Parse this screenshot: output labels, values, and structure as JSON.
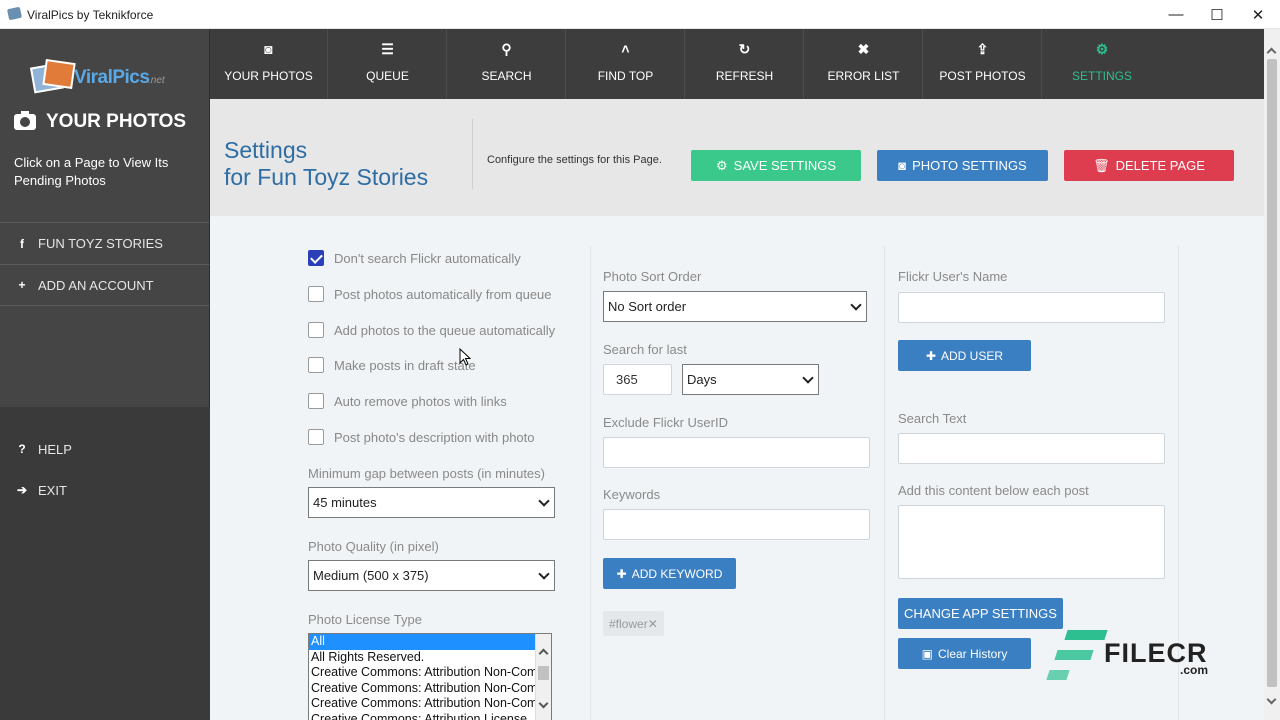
{
  "window": {
    "title": "ViralPics by Teknikforce",
    "minimize": "—",
    "maximize": "☐",
    "close": "✕"
  },
  "sidebar": {
    "logo_text": "ViralPics",
    "logo_suffix": ".net",
    "heading": "YOUR PHOTOS",
    "description": "Click on a Page to View Its Pending Photos",
    "pages": [
      {
        "label": "FUN TOYZ STORIES",
        "icon": "facebook-icon",
        "glyph": "f"
      }
    ],
    "add_account": {
      "label": "ADD AN ACCOUNT",
      "icon": "plus-circle-icon",
      "glyph": "+"
    },
    "help": {
      "label": "HELP",
      "icon": "question-icon",
      "glyph": "?"
    },
    "exit": {
      "label": "EXIT",
      "icon": "exit-arrow-icon",
      "glyph": "➔"
    }
  },
  "topnav": [
    {
      "label": "YOUR PHOTOS",
      "icon": "camera-icon",
      "glyph": "◙"
    },
    {
      "label": "QUEUE",
      "icon": "list-icon",
      "glyph": "☰"
    },
    {
      "label": "SEARCH",
      "icon": "search-icon",
      "glyph": "⚲"
    },
    {
      "label": "FIND TOP",
      "icon": "chevron-up-icon",
      "glyph": "˄"
    },
    {
      "label": "REFRESH",
      "icon": "refresh-icon",
      "glyph": "↻"
    },
    {
      "label": "ERROR LIST",
      "icon": "times-icon",
      "glyph": "✖"
    },
    {
      "label": "POST PHOTOS",
      "icon": "upload-icon",
      "glyph": "⇪"
    },
    {
      "label": "SETTINGS",
      "icon": "gear-icon",
      "glyph": "⚙",
      "active": true
    }
  ],
  "header": {
    "title_line1": "Settings",
    "title_line2": "for Fun Toyz Stories",
    "config_text": "Configure the settings for this Page.",
    "save_settings": "SAVE SETTINGS",
    "photo_settings": "PHOTO SETTINGS",
    "delete_page": "DELETE PAGE",
    "colors": {
      "save": "#3ac98b",
      "photo": "#3a7fc2",
      "delete": "#de3d4f"
    }
  },
  "options": [
    {
      "label": "Don't search Flickr automatically",
      "checked": true
    },
    {
      "label": "Post photos automatically from queue",
      "checked": false
    },
    {
      "label": "Add photos to the queue automatically",
      "checked": false
    },
    {
      "label": "Make posts in draft state",
      "checked": false
    },
    {
      "label": "Auto remove photos with links",
      "checked": false
    },
    {
      "label": "Post photo's description with photo",
      "checked": false
    }
  ],
  "min_gap": {
    "label": "Minimum gap between posts (in minutes)",
    "value": "45 minutes"
  },
  "photo_quality": {
    "label": "Photo Quality (in pixel)",
    "value": "Medium (500 x 375)"
  },
  "license": {
    "label": "Photo License Type",
    "options": [
      {
        "text": "All",
        "selected": true
      },
      {
        "text": "All Rights Reserved."
      },
      {
        "text": "Creative Commons: Attribution Non-Commercial"
      },
      {
        "text": "Creative Commons: Attribution Non-Commercial"
      },
      {
        "text": "Creative Commons: Attribution Non-Commercial"
      },
      {
        "text": "Creative Commons: Attribution License"
      }
    ]
  },
  "sort_order": {
    "label": "Photo Sort Order",
    "value": "No Sort order"
  },
  "search_last": {
    "label": "Search for last",
    "number": "365",
    "unit": "Days"
  },
  "exclude_user": {
    "label": "Exclude Flickr UserID",
    "value": ""
  },
  "keywords": {
    "label": "Keywords",
    "value": "",
    "add_button": "ADD KEYWORD",
    "tags": [
      "#flower"
    ],
    "tag_remove": "✕"
  },
  "flickr_user": {
    "label": "Flickr User's Name",
    "value": "",
    "add_button": "ADD USER"
  },
  "search_text": {
    "label": "Search Text",
    "value": ""
  },
  "below_content": {
    "label": "Add this content below each post",
    "value": ""
  },
  "change_app_settings": "CHANGE APP SETTINGS",
  "clear_history": "Clear History",
  "watermark": {
    "text": "FILECR",
    "suffix": ".com"
  }
}
